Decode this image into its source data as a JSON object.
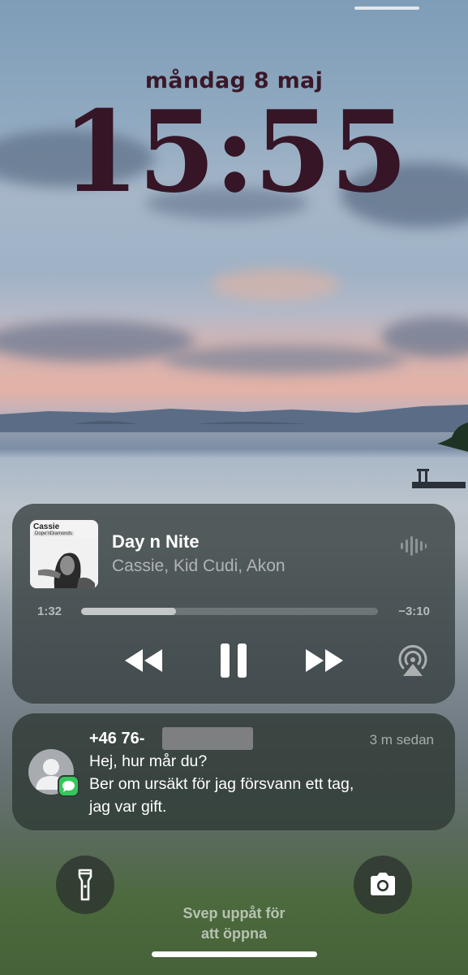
{
  "lock_screen": {
    "date": "måndag 8 maj",
    "time": "15:55",
    "swipe_hint_line1": "Svep uppåt för",
    "swipe_hint_line2": "att öppna"
  },
  "now_playing": {
    "album_art_artist": "Cassie",
    "album_art_title": "Dope'nDiamonds",
    "title": "Day n Nite",
    "artist": "Cassie, Kid Cudi, Akon",
    "elapsed": "1:32",
    "remaining": "−3:10",
    "progress": 0.32,
    "icons": [
      "rewind-icon",
      "pause-icon",
      "fast-forward-icon",
      "airplay-icon",
      "waveform-icon"
    ]
  },
  "notification": {
    "sender": "+46 76-",
    "time_ago": "3 m sedan",
    "lines": [
      "Hej, hur mår du?",
      "Ber om ursäkt för jag försvann ett tag,",
      "jag var gift."
    ],
    "icons": [
      "contact-avatar-icon",
      "messages-icon"
    ]
  },
  "quick_actions": {
    "icons": [
      "flashlight-icon",
      "camera-icon"
    ]
  },
  "colors": {
    "clock": "#351526",
    "accent_green": "#34c759"
  }
}
